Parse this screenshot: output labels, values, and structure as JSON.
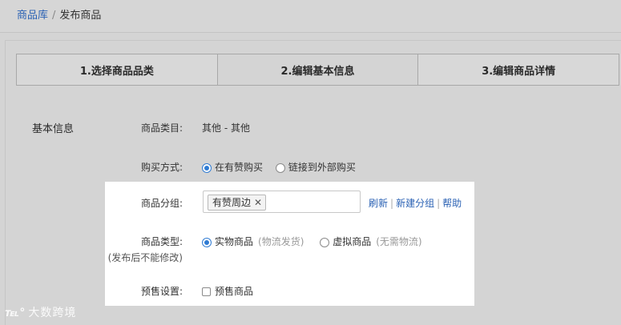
{
  "breadcrumb": {
    "parent": "商品库",
    "separator": "/",
    "current": "发布商品"
  },
  "steps": [
    {
      "label": "1.选择商品品类",
      "active": false
    },
    {
      "label": "2.编辑基本信息",
      "active": true
    },
    {
      "label": "3.编辑商品详情",
      "active": false
    }
  ],
  "section_title": "基本信息",
  "form": {
    "category": {
      "label": "商品类目:",
      "value": "其他 - 其他"
    },
    "purchase": {
      "label": "购买方式:",
      "options": [
        {
          "label": "在有赞购买",
          "checked": true
        },
        {
          "label": "链接到外部购买",
          "checked": false
        }
      ]
    },
    "group": {
      "label": "商品分组:",
      "tag": "有赞周边",
      "tag_close": "✕",
      "links": [
        "刷新",
        "新建分组",
        "帮助"
      ],
      "link_separator": "|"
    },
    "type": {
      "label": "商品类型:",
      "sublabel": "(发布后不能修改)",
      "options": [
        {
          "label": "实物商品",
          "hint": "(物流发货)",
          "checked": true
        },
        {
          "label": "虚拟商品",
          "hint": "(无需物流)",
          "checked": false
        }
      ]
    },
    "presale": {
      "label": "预售设置:",
      "checkbox_label": "预售商品",
      "checked": false
    }
  },
  "watermark": {
    "logo": "℡°",
    "text": "大数跨境"
  },
  "colors": {
    "link": "#2b62b4",
    "radio_accent": "#2f7bd3",
    "overlay": "#d4d4d4",
    "highlight": "#ffffff"
  }
}
